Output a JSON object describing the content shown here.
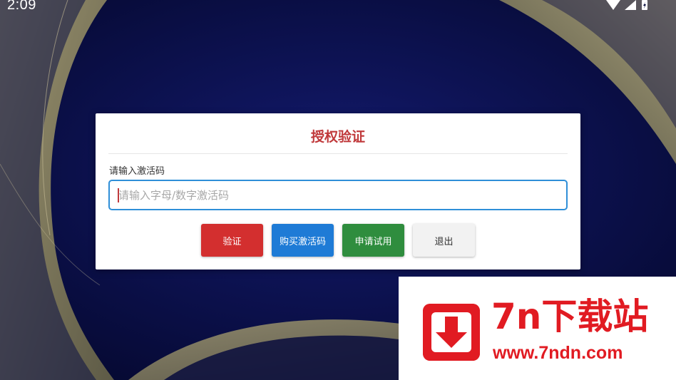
{
  "status_bar": {
    "time": "2:09",
    "icons": [
      "wifi-icon",
      "cellular-signal-icon",
      "battery-icon"
    ]
  },
  "dialog": {
    "title": "授权验证",
    "field_label": "请输入激活码",
    "input": {
      "value": "",
      "placeholder": "请输入字母/数字激活码"
    },
    "buttons": {
      "verify": "验证",
      "buy": "购买激活码",
      "trial": "申请试用",
      "exit": "退出"
    }
  },
  "watermark": {
    "brand": "7n下载站",
    "url": "www.7ndn.com"
  },
  "colors": {
    "title": "#c0393b",
    "input_border": "#2f8fd8",
    "verify_button": "#d32f2f",
    "buy_button": "#1e7bd6",
    "trial_button": "#2f8d3e",
    "exit_button": "#f2f2f2",
    "watermark_red": "#e11b22"
  }
}
